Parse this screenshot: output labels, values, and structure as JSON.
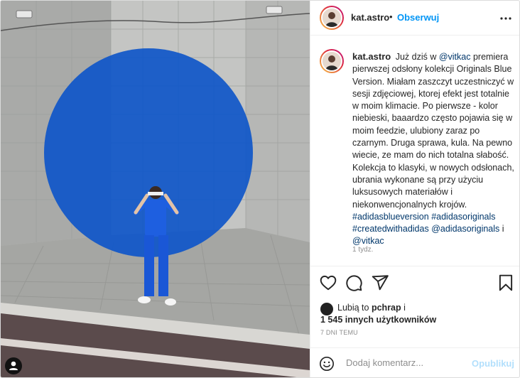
{
  "header": {
    "username": "kat.astro",
    "separator": "•",
    "follow_label": "Obserwuj",
    "more_icon": "ellipsis-icon"
  },
  "caption": {
    "username": "kat.astro",
    "text_1": "Już dziś w ",
    "mention_vitkac": "@vitkac",
    "text_2": " premiera pierwszej odsłony kolekcji Originals Blue Version. Miałam zaszczyt uczestniczyć w sesji zdjęciowej, ktorej efekt jest totalnie w moim klimacie. Po pierwsze - kolor niebieski, baaardzo często pojawia się w moim feedzie, ulubiony zaraz po czarnym. Druga sprawa, kula. Na pewno wiecie, ze mam do nich totalna słabość. Kolekcja to klasyki, w nowych odsłonach, ubrania wykonane są przy użyciu luksusowych materiałów i niekonwencjonalnych krojów.",
    "hashtag_1": "#adidasblueversion",
    "hashtag_2": "#adidasoriginals",
    "hashtag_3": "#createdwithadidas",
    "mention_adidasoriginals": "@adidasoriginals",
    "conj": " i ",
    "mention_vitkac_2": "@vitkac",
    "time": "1 tydz."
  },
  "actions": {
    "like_icon": "heart-icon",
    "comment_icon": "comment-icon",
    "share_icon": "share-icon",
    "save_icon": "bookmark-icon"
  },
  "likes": {
    "prefix": "Lubią to ",
    "user": "pchrap",
    "suffix": " i",
    "count_text": "1 545 innych użytkowników"
  },
  "date": "7 DNI TEMU",
  "comment": {
    "placeholder": "Dodaj komentarz...",
    "post_label": "Opublikuj",
    "emoji_icon": "smiley-icon"
  },
  "photo": {
    "circle_color": "#0f56c9",
    "tag_icon": "user-tag-icon"
  },
  "colors": {
    "accent": "#0095f6",
    "link": "#00376b",
    "muted": "#8e8e8e"
  }
}
